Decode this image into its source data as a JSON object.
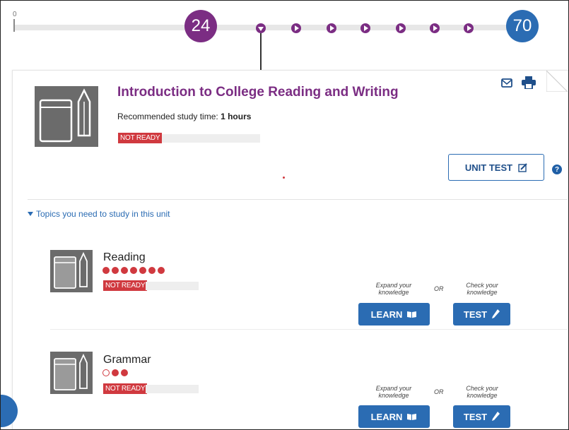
{
  "progress": {
    "zero_label": "0",
    "current_value": "24",
    "target_value": "70"
  },
  "unit": {
    "title": "Introduction to College Reading and Writing",
    "study_label": "Recommended study time:",
    "study_value": "1 hours",
    "status": "NOT READY",
    "unit_test_label": "UNIT TEST",
    "help_label": "?"
  },
  "topics_header": "Topics you need to study in this unit",
  "topics": [
    {
      "name": "Reading",
      "status": "NOT READY",
      "mastery_filled": 7,
      "mastery_total": 7,
      "learn_caption": "Expand your knowledge",
      "or_label": "OR",
      "test_caption": "Check your knowledge",
      "learn_label": "LEARN",
      "test_label": "TEST"
    },
    {
      "name": "Grammar",
      "status": "NOT READY",
      "mastery_filled": 2,
      "mastery_total": 3,
      "learn_caption": "Expand your knowledge",
      "or_label": "OR",
      "test_caption": "Check your knowledge",
      "learn_label": "LEARN",
      "test_label": "TEST"
    }
  ],
  "colors": {
    "accent_purple": "#7b2d83",
    "accent_blue": "#2b6cb3",
    "status_red": "#d0393f"
  }
}
